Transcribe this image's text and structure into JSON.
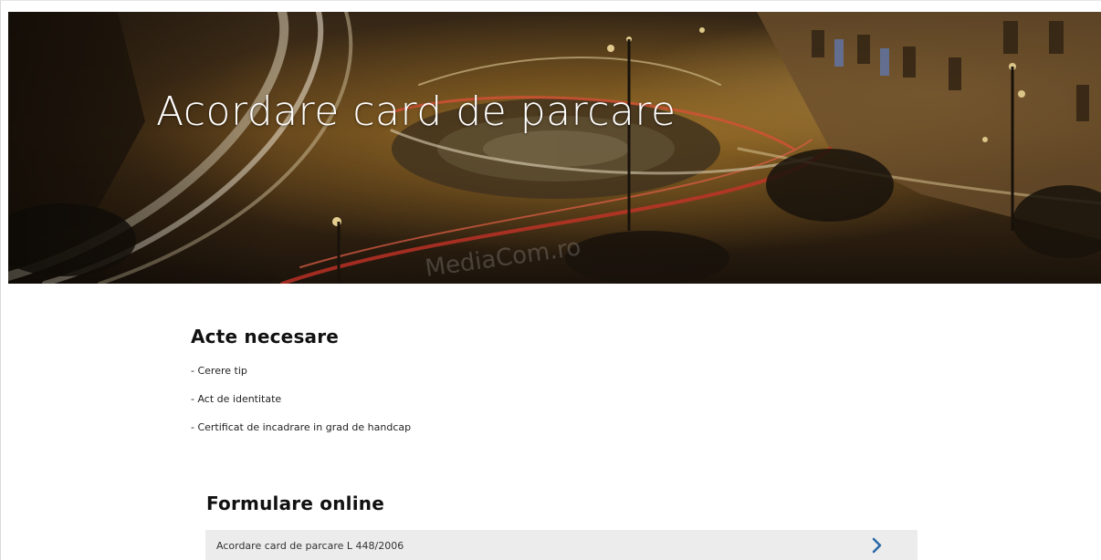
{
  "hero": {
    "title": "Acordare card de parcare",
    "watermark": "MediaCom.ro"
  },
  "required_docs": {
    "title": "Acte necesare",
    "items": [
      "- Cerere tip",
      "- Act de identitate",
      "- Certificat de incadrare in grad de handcap"
    ]
  },
  "online_forms": {
    "title": "Formulare online",
    "items": [
      {
        "label": "Acordare card de parcare L 448/2006",
        "icon": "chevron-right-icon"
      }
    ]
  },
  "colors": {
    "accent": "#2b6aa8",
    "row_background": "#ececec",
    "heading": "#111111"
  }
}
